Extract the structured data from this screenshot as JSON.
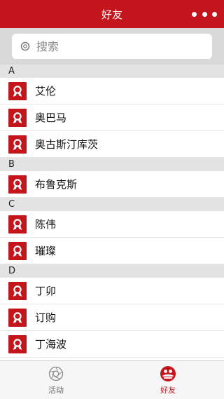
{
  "header": {
    "title": "好友",
    "more_icon": "more-dots-icon"
  },
  "search": {
    "placeholder": "搜索",
    "icon": "search-icon"
  },
  "colors": {
    "brand": "#c4151c",
    "group_bg": "#e3e3e3",
    "search_bg": "#d9d9d9"
  },
  "groups": [
    {
      "letter": "A",
      "contacts": [
        "艾伦",
        "奥巴马",
        "奥古斯汀库茨"
      ]
    },
    {
      "letter": "B",
      "contacts": [
        "布鲁克斯"
      ]
    },
    {
      "letter": "C",
      "contacts": [
        "陈伟",
        "璀璨"
      ]
    },
    {
      "letter": "D",
      "contacts": [
        "丁卯",
        "订购",
        "丁海波"
      ]
    }
  ],
  "tabs": [
    {
      "label": "活动",
      "icon": "aperture-icon",
      "active": false
    },
    {
      "label": "好友",
      "icon": "friends-icon",
      "active": true
    }
  ]
}
